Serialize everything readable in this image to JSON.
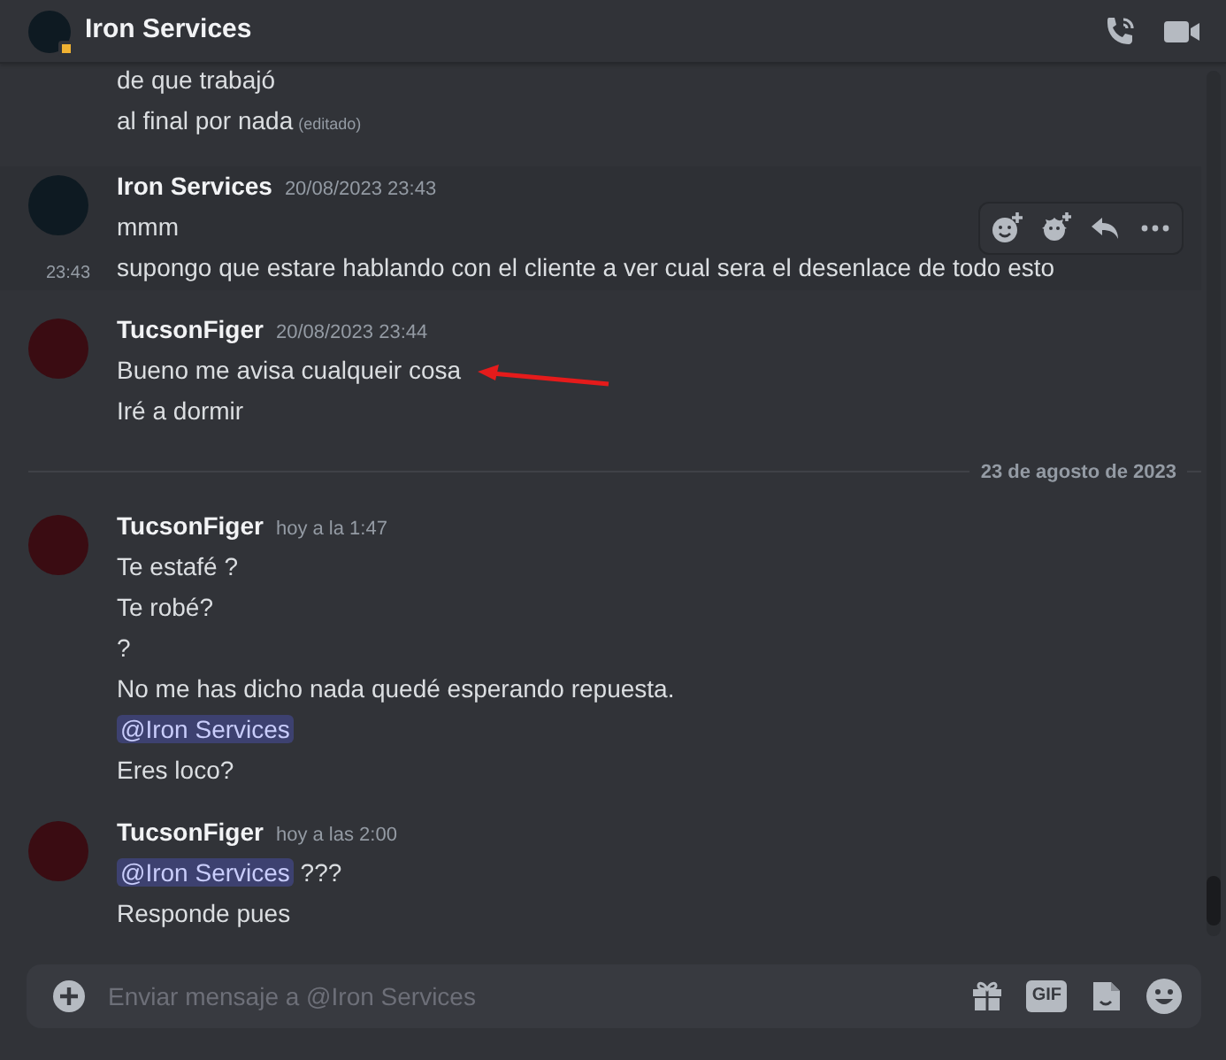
{
  "header": {
    "title": "Iron Services"
  },
  "messages": [
    {
      "kind": "continuation",
      "hovered": false,
      "lines": [
        {
          "text": "de que trabajó"
        },
        {
          "text": "al final por nada",
          "edited": "(editado)"
        }
      ]
    },
    {
      "kind": "group",
      "hovered": true,
      "author": "Iron Services",
      "color": "#0e1a22",
      "timestamp": "20/08/2023 23:43",
      "lines": [
        {
          "text": "mmm"
        },
        {
          "text": "supongo que estare hablando con el cliente a ver cual sera el desenlace de todo esto",
          "hover_time": "23:43"
        }
      ]
    },
    {
      "kind": "group",
      "hovered": false,
      "author": "TucsonFiger",
      "color": "#3a0c12",
      "timestamp": "20/08/2023 23:44",
      "lines": [
        {
          "text": "Bueno me avisa cualqueir cosa",
          "arrow": true
        },
        {
          "text": "Iré a dormir"
        }
      ]
    },
    {
      "kind": "divider",
      "label": "23 de agosto de 2023"
    },
    {
      "kind": "group",
      "hovered": false,
      "author": "TucsonFiger",
      "color": "#3a0c12",
      "timestamp": "hoy a la 1:47",
      "lines": [
        {
          "text": "Te estafé ?"
        },
        {
          "text": "Te robé?"
        },
        {
          "text": "?"
        },
        {
          "text": "No me has dicho nada quedé esperando repuesta."
        },
        {
          "mention": "@Iron Services"
        },
        {
          "text": "Eres loco?"
        }
      ]
    },
    {
      "kind": "group",
      "hovered": false,
      "author": "TucsonFiger",
      "color": "#3a0c12",
      "timestamp": "hoy a las 2:00",
      "lines": [
        {
          "mention": "@Iron Services",
          "text": "???"
        },
        {
          "text": "Responde pues"
        }
      ]
    }
  ],
  "composer": {
    "placeholder": "Enviar mensaje a @Iron Services",
    "gif_label": "GIF"
  }
}
